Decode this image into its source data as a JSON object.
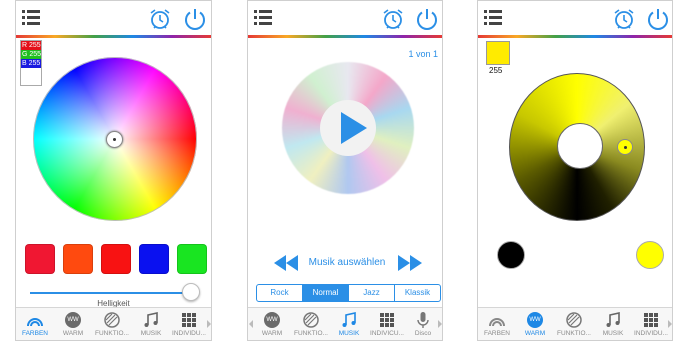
{
  "colors": {
    "accent": "#2b8fe6",
    "icon_gray": "#444444",
    "tab_gray": "#8a8a8a"
  },
  "panel1": {
    "rgb": {
      "r": "R 255",
      "g": "G 255",
      "b": "B 255"
    },
    "presets": [
      "#f01732",
      "#ff4a0f",
      "#f81212",
      "#0a11f0",
      "#19e521"
    ],
    "brightness_label": "Helligkeit",
    "brightness": 0.95,
    "tabs": [
      {
        "label": "FARBEN",
        "icon": "rainbow-icon",
        "active": true
      },
      {
        "label": "WARM",
        "icon": "ww-icon",
        "badge": "WW",
        "active": false
      },
      {
        "label": "FUNKTIO...",
        "icon": "striped-circle-icon",
        "active": false
      },
      {
        "label": "MUSIK",
        "icon": "music-note-icon",
        "active": false
      },
      {
        "label": "INDIVIDU...",
        "icon": "grid-icon",
        "active": false
      }
    ]
  },
  "panel2": {
    "counter": "1 von 1",
    "music_label": "Musik auswählen",
    "genres": [
      "Rock",
      "Normal",
      "Jazz",
      "Klassik"
    ],
    "selected_genre": "Normal",
    "tabs": [
      {
        "label": "WARM",
        "icon": "ww-icon",
        "badge": "WW",
        "active": false
      },
      {
        "label": "FUNKTIO...",
        "icon": "striped-circle-icon",
        "active": false
      },
      {
        "label": "MUSIK",
        "icon": "music-note-icon",
        "active": true
      },
      {
        "label": "INDIVICU...",
        "icon": "grid-icon",
        "active": false
      },
      {
        "label": "Disco",
        "icon": "microphone-icon",
        "active": false
      }
    ]
  },
  "panel3": {
    "swatch_color": "#ffeb00",
    "value": "255",
    "left_circle_color": "#000000",
    "right_circle_color": "#ffff00",
    "tabs": [
      {
        "label": "FARBEN",
        "icon": "rainbow-icon",
        "active": false
      },
      {
        "label": "WARM",
        "icon": "ww-icon",
        "badge": "WW",
        "active": true
      },
      {
        "label": "FUNKTIO...",
        "icon": "striped-circle-icon",
        "active": false
      },
      {
        "label": "MUSIK",
        "icon": "music-note-icon",
        "active": false
      },
      {
        "label": "INDIVIDU...",
        "icon": "grid-icon",
        "active": false
      }
    ]
  }
}
